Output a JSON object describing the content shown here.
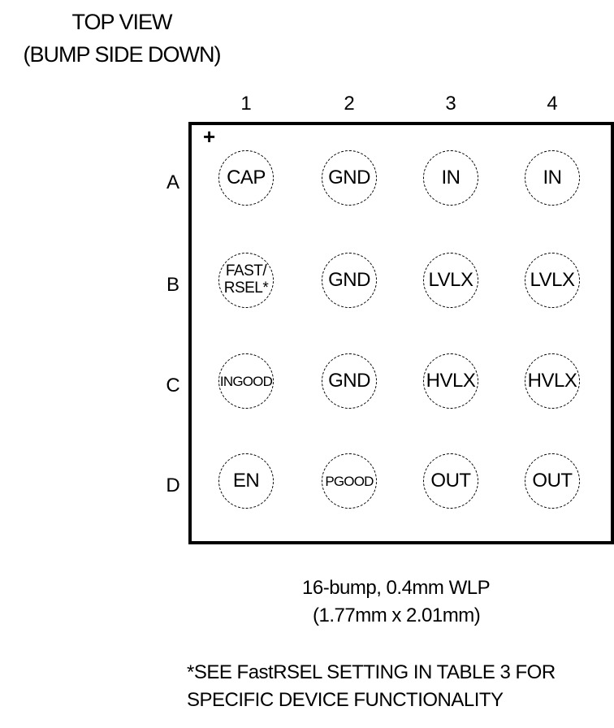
{
  "title": {
    "line1": "TOP VIEW",
    "line2": "(BUMP SIDE DOWN)"
  },
  "columns": [
    "1",
    "2",
    "3",
    "4"
  ],
  "rows": [
    "A",
    "B",
    "C",
    "D"
  ],
  "pin1_marker": "+",
  "bumps": [
    [
      "CAP",
      "GND",
      "IN",
      "IN"
    ],
    [
      "FAST/\nRSEL*",
      "GND",
      "LVLX",
      "LVLX"
    ],
    [
      "INGOOD",
      "GND",
      "HVLX",
      "HVLX"
    ],
    [
      "EN",
      "PGOOD",
      "OUT",
      "OUT"
    ]
  ],
  "package": {
    "line1": "16-bump, 0.4mm WLP",
    "line2": "(1.77mm x 2.01mm)"
  },
  "footnote": {
    "line1": "*SEE FastRSEL SETTING IN TABLE 3 FOR",
    "line2": "SPECIFIC DEVICE FUNCTIONALITY"
  }
}
